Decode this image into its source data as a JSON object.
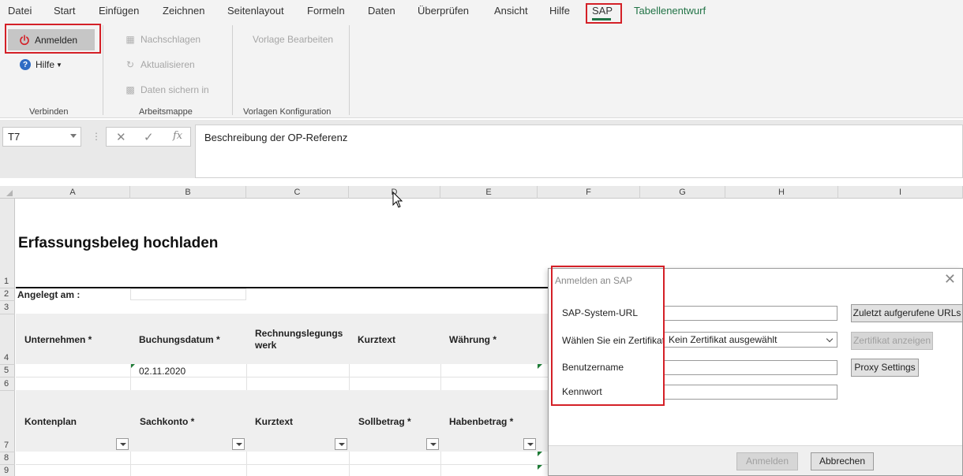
{
  "menu": {
    "items": [
      "Datei",
      "Start",
      "Einfügen",
      "Zeichnen",
      "Seitenlayout",
      "Formeln",
      "Daten",
      "Überprüfen",
      "Ansicht",
      "Hilfe",
      "SAP",
      "Tabellenentwurf"
    ]
  },
  "ribbon": {
    "verbinden": {
      "anmelden_label": "Anmelden",
      "hilfe_label": "Hilfe",
      "group_label": "Verbinden"
    },
    "arbeitsmappe": {
      "nachschlagen_label": "Nachschlagen",
      "aktualisieren_label": "Aktualisieren",
      "daten_sichern_label": "Daten sichern in",
      "group_label": "Arbeitsmappe"
    },
    "vorlagen": {
      "vorlage_bearbeiten_label": "Vorlage Bearbeiten",
      "group_label": "Vorlagen Konfiguration"
    }
  },
  "formula_bar": {
    "name_box": "T7",
    "fx_label": "fx",
    "formula": "Beschreibung der OP-Referenz"
  },
  "sheet": {
    "columns": [
      "A",
      "B",
      "C",
      "D",
      "E",
      "F",
      "G",
      "H",
      "I"
    ],
    "rows": [
      "1",
      "2",
      "3",
      "4",
      "5",
      "6",
      "7",
      "8",
      "9"
    ],
    "title": "Erfassungsbeleg hochladen",
    "angelegt_label": "Angelegt am :",
    "header1": {
      "unternehmen": "Unternehmen *",
      "buchungsdatum": "Buchungsdatum *",
      "rechnungslegungswerk_line1": "Rechnungslegungs",
      "rechnungslegungswerk_line2": "werk",
      "kurztext": "Kurztext",
      "waehrung": "Währung *"
    },
    "date_value": "02.11.2020",
    "header2": {
      "kontenplan": "Kontenplan",
      "sachkonto": "Sachkonto *",
      "kurztext": "Kurztext",
      "sollbetrag": "Sollbetrag *",
      "habenbetrag": "Habenbetrag *"
    }
  },
  "dialog": {
    "title": "Anmelden an SAP",
    "labels": {
      "url": "SAP-System-URL",
      "zertifikat": "Wählen Sie ein Zertifikat",
      "benutzername": "Benutzername",
      "kennwort": "Kennwort"
    },
    "zertifikat_value": "Kein Zertifikat ausgewählt",
    "buttons": {
      "zuletzt": "Zuletzt aufgerufene URLs",
      "zertifikat_anzeigen": "Zertifikat anzeigen",
      "proxy": "Proxy Settings",
      "anmelden": "Anmelden",
      "abbrechen": "Abbrechen"
    }
  },
  "colors": {
    "excel_green": "#217346",
    "highlight_red": "#d42027",
    "anmelden_bg": "#c6c6c6"
  }
}
